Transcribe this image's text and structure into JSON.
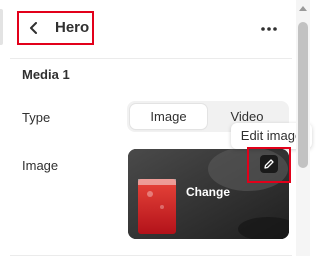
{
  "header": {
    "back_title": "Hero",
    "more_label": "More actions"
  },
  "section": {
    "title": "Media 1"
  },
  "type_row": {
    "label": "Type",
    "options": [
      "Image",
      "Video"
    ],
    "selected": "Image"
  },
  "image_row": {
    "label": "Image",
    "change_label": "Change",
    "edit_tooltip": "Edit image"
  },
  "icons": {
    "back": "chevron-left-icon",
    "more": "ellipsis-icon",
    "edit": "pencil-icon"
  },
  "colors": {
    "highlight_box": "#e2001a",
    "text": "#303030"
  }
}
